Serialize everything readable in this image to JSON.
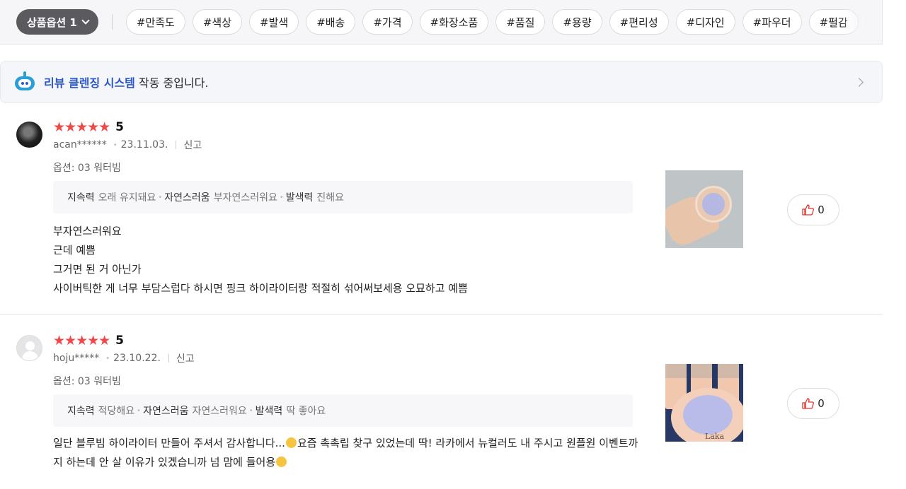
{
  "filter_bar": {
    "option_button": "상품옵션 1",
    "tags": [
      "#만족도",
      "#색상",
      "#발색",
      "#배송",
      "#가격",
      "#화장소품",
      "#품질",
      "#용량",
      "#편리성",
      "#디자인",
      "#파우더",
      "#펄감"
    ]
  },
  "banner": {
    "highlight": "리뷰 클렌징 시스템",
    "rest": " 작동 중입니다."
  },
  "reviews": [
    {
      "stars": "★★★★★",
      "score": "5",
      "user": "acan******",
      "date": "23.11.03.",
      "report": "신고",
      "option": "옵션: 03 워터빔",
      "attrs": [
        {
          "key": "지속력",
          "value": "오래 유지돼요"
        },
        {
          "key": "자연스러움",
          "value": "부자연스러워요"
        },
        {
          "key": "발색력",
          "value": "진해요"
        }
      ],
      "lines": [
        "부자연스러워요",
        "근데 예쁨",
        "그거면 된 거 아닌가",
        "사이버틱한 게 너무 부담스럽다 하시면 핑크 하이라이터랑 적절히 섞어써보세용 오묘하고 예쁨"
      ],
      "likes": "0"
    },
    {
      "stars": "★★★★★",
      "score": "5",
      "user": "hoju*****",
      "date": "23.10.22.",
      "report": "신고",
      "option": "옵션: 03 워터빔",
      "attrs": [
        {
          "key": "지속력",
          "value": "적당해요"
        },
        {
          "key": "자연스러움",
          "value": "자연스러워요"
        },
        {
          "key": "발색력",
          "value": "딱 좋아요"
        }
      ],
      "text_a": "일단 블루빔 하이라이터 만들어 주셔서 감사합니다...",
      "text_b": "요즘 촉촉립 찾구 있었는데 딱! 라카에서 뉴컬러도 내 주시고 원플원 이벤트까지 하는데 안 살 이유가 있겠습니까 넘 맘에 들어용",
      "likes": "0",
      "image_text": "Laka"
    }
  ]
}
